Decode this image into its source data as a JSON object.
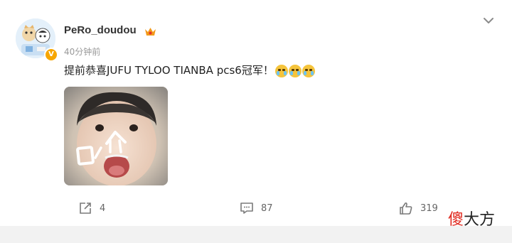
{
  "post": {
    "username": "PeRo_doudou",
    "time": "40分钟前",
    "text": "提前恭喜JUFU TYLOO TIANBA pcs6冠军！",
    "emojis": [
      "cry-emoji",
      "cry-emoji",
      "cry-emoji"
    ]
  },
  "actions": {
    "share_count": "4",
    "comment_count": "87",
    "like_count": "319"
  },
  "watermark": {
    "first_char": "傻",
    "rest": "大方"
  },
  "colors": {
    "username": "#333333",
    "time": "#999999",
    "verified_badge": "#f7a600",
    "watermark_accent": "#e0281e",
    "icon_gray": "#7a7a7a"
  }
}
